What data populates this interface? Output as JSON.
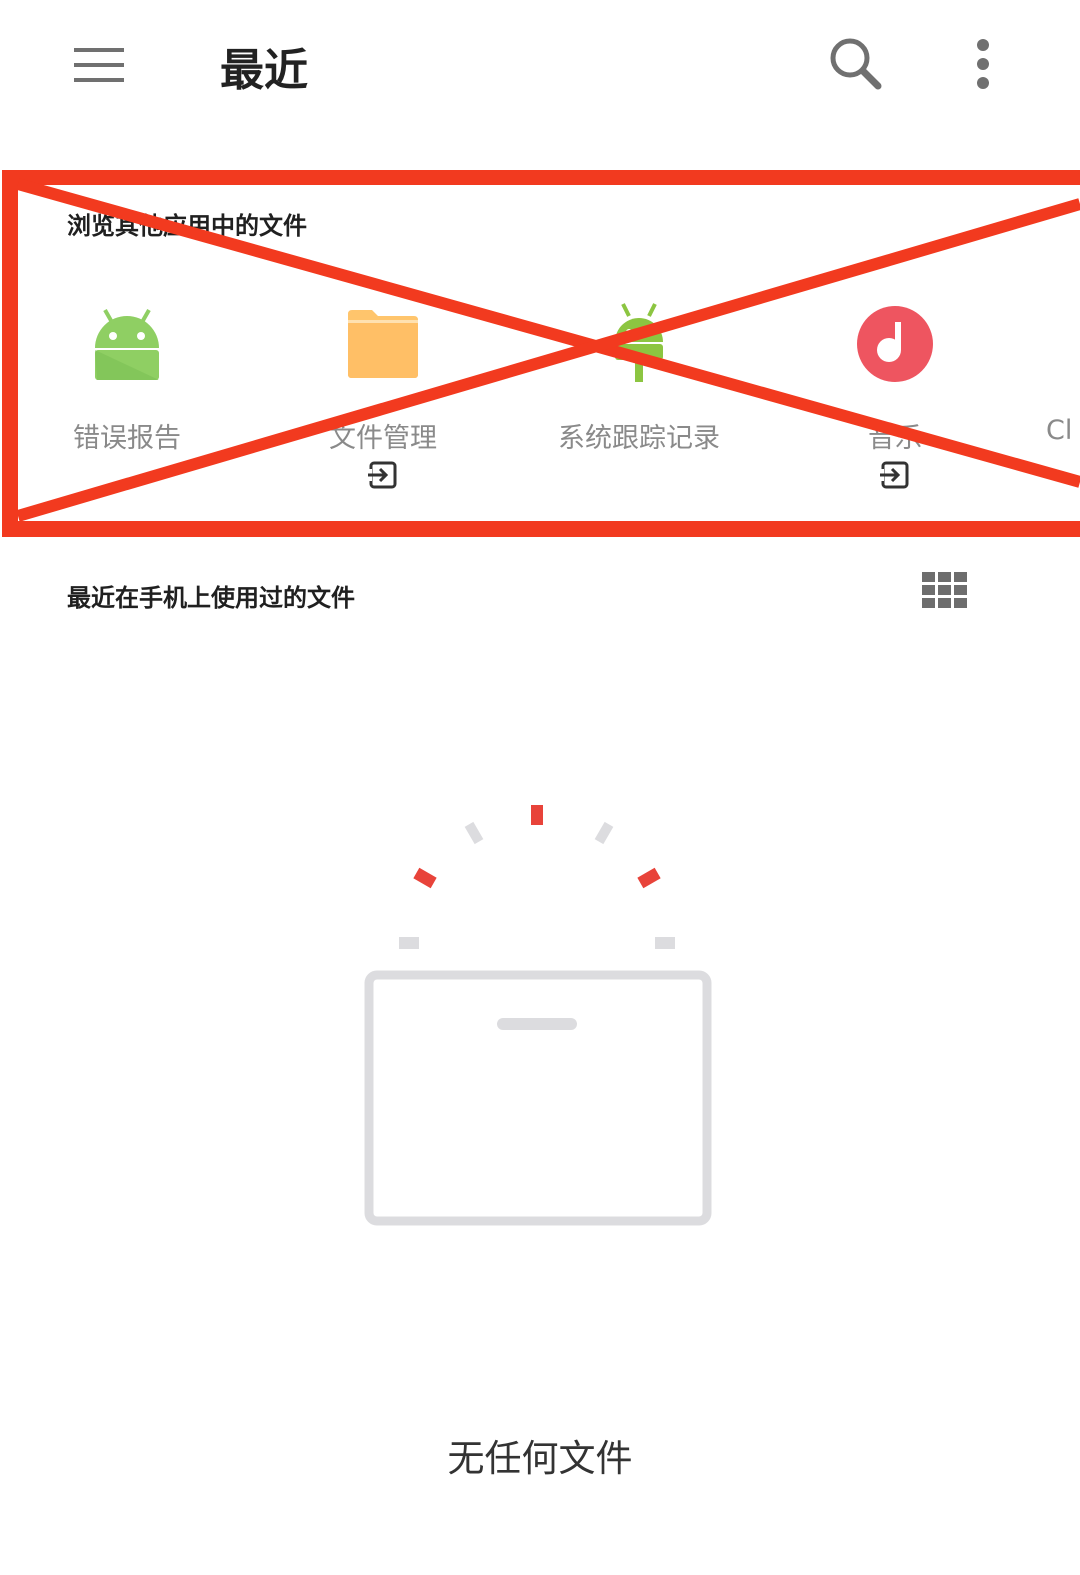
{
  "appbar": {
    "title": "最近",
    "menu_icon": "hamburger-menu-icon",
    "search_icon": "search-icon",
    "more_icon": "more-vert-icon"
  },
  "apps_section": {
    "heading": "浏览其他应用中的文件",
    "apps": [
      {
        "label": "错误报告",
        "icon": "android-bug-report-icon",
        "has_open_badge": false
      },
      {
        "label": "文件管理",
        "icon": "folder-icon",
        "has_open_badge": true
      },
      {
        "label": "系统跟踪记录",
        "icon": "android-trace-icon",
        "has_open_badge": false
      },
      {
        "label": "音乐",
        "icon": "music-icon",
        "has_open_badge": true
      },
      {
        "label": "Cl",
        "icon": "",
        "has_open_badge": false
      }
    ],
    "overlay_color": "#f23a1f"
  },
  "recent_section": {
    "heading": "最近在手机上使用过的文件",
    "view_toggle_icon": "grid-view-icon",
    "empty_text": "无任何文件"
  },
  "colors": {
    "android_green": "#8fcf63",
    "folder_orange": "#ffbf66",
    "music_red": "#ee5560",
    "accent_red": "#e8433a",
    "art_gray": "#dcdcdf"
  }
}
